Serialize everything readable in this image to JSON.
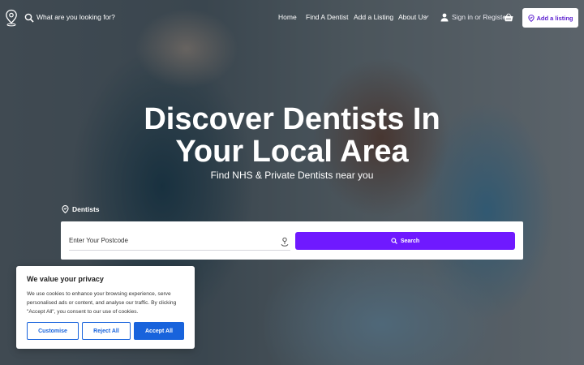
{
  "header": {
    "search_placeholder": "What are you looking for?",
    "nav": [
      {
        "label": "Home"
      },
      {
        "label": "Find A Dentist"
      },
      {
        "label": "Add a Listing"
      },
      {
        "label": "About Us"
      }
    ],
    "signin_label": "Sign in or Register",
    "add_listing_button": "Add a listing"
  },
  "hero": {
    "title_line1": "Discover Dentists In",
    "title_line2": "Your Local Area",
    "subtitle": "Find NHS & Private Dentists near you"
  },
  "search": {
    "category_label": "Dentists",
    "postcode_placeholder": "Enter Your Postcode",
    "search_button": "Search"
  },
  "cookie": {
    "title": "We value your privacy",
    "text": "We use cookies to enhance your browsing experience, serve personalised ads or content, and analyse our traffic. By clicking \"Accept All\", you consent to our use of cookies.",
    "customise": "Customise",
    "reject": "Reject All",
    "accept": "Accept All"
  },
  "colors": {
    "brand_purple": "#6f19ff",
    "cookie_blue": "#1863dc"
  },
  "icons": [
    "map-pin-logo-icon",
    "search-icon",
    "chevron-down-icon",
    "user-icon",
    "basket-icon",
    "map-pin-icon",
    "location-target-icon"
  ]
}
